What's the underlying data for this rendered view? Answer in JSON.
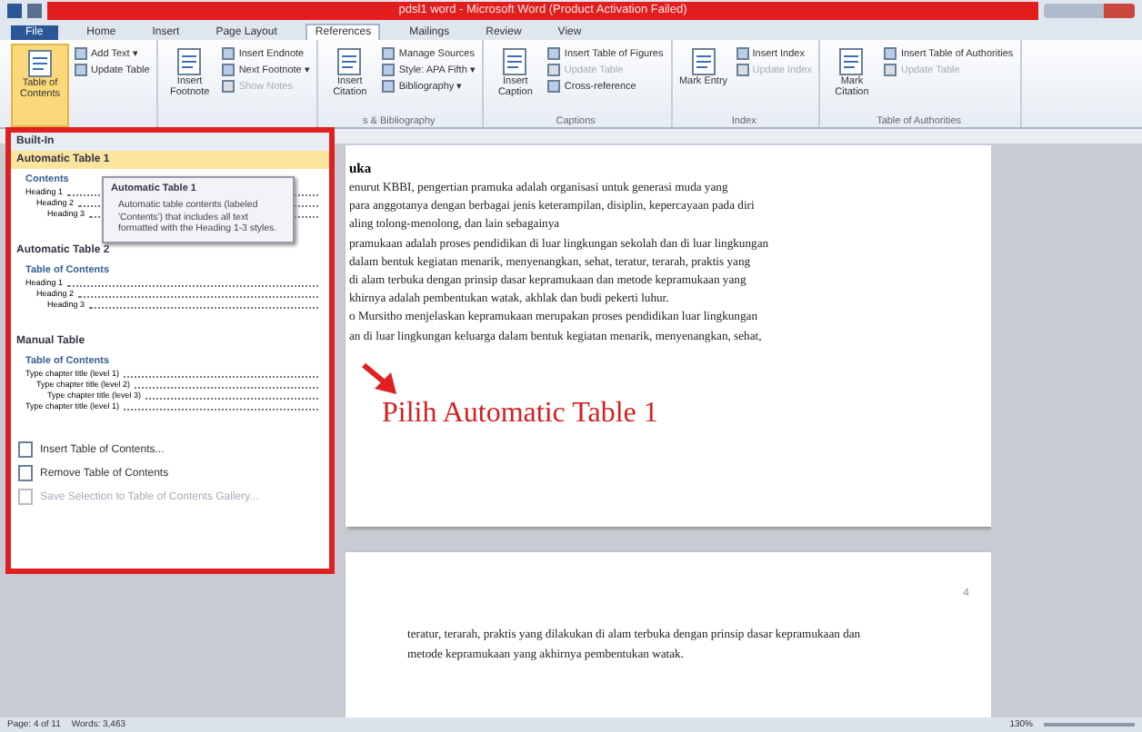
{
  "window": {
    "title": "pdsl1 word - Microsoft Word (Product Activation Failed)"
  },
  "tabs": [
    {
      "label": "File",
      "selected": false,
      "kind": "file"
    },
    {
      "label": "Home",
      "selected": false
    },
    {
      "label": "Insert",
      "selected": false
    },
    {
      "label": "Page Layout",
      "selected": false
    },
    {
      "label": "References",
      "selected": true
    },
    {
      "label": "Mailings",
      "selected": false
    },
    {
      "label": "Review",
      "selected": false
    },
    {
      "label": "View",
      "selected": false
    }
  ],
  "ribbon": [
    {
      "big": {
        "label": "Table of Contents",
        "selected": true
      },
      "small": [
        {
          "label": "Add Text ▾",
          "disabled": false
        },
        {
          "label": "Update Table",
          "disabled": false
        }
      ]
    },
    {
      "big": {
        "label": "Insert Footnote",
        "selected": false
      },
      "small": [
        {
          "label": "Insert Endnote",
          "disabled": false
        },
        {
          "label": "Next Footnote ▾",
          "disabled": false
        },
        {
          "label": "Show Notes",
          "disabled": true
        }
      ]
    },
    {
      "big": {
        "label": "Insert Citation",
        "selected": false
      },
      "small": [
        {
          "label": "Manage Sources",
          "disabled": false
        },
        {
          "label": "Style: APA Fifth ▾",
          "disabled": false
        },
        {
          "label": "Bibliography ▾",
          "disabled": false
        }
      ],
      "label": "s & Bibliography"
    },
    {
      "big": {
        "label": "Insert Caption",
        "selected": false
      },
      "small": [
        {
          "label": "Insert Table of Figures",
          "disabled": false
        },
        {
          "label": "Update Table",
          "disabled": true
        },
        {
          "label": "Cross-reference",
          "disabled": false
        }
      ],
      "label": "Captions"
    },
    {
      "big": {
        "label": "Mark Entry",
        "selected": false
      },
      "small": [
        {
          "label": "Insert Index",
          "disabled": false
        },
        {
          "label": "Update Index",
          "disabled": true
        }
      ],
      "label": "Index"
    },
    {
      "big": {
        "label": "Mark Citation",
        "selected": false
      },
      "small": [
        {
          "label": "Insert Table of Authorities",
          "disabled": false
        },
        {
          "label": "Update Table",
          "disabled": true
        }
      ],
      "label": "Table of Authorities"
    }
  ],
  "menu": {
    "header": "Built-In",
    "items": [
      {
        "title": "Automatic Table 1",
        "selected": true,
        "heading": "Contents",
        "lines": [
          "Heading 1",
          "Heading 2",
          "Heading 3"
        ]
      },
      {
        "title": "Automatic Table 2",
        "selected": false,
        "heading": "Table of Contents",
        "lines": [
          "Heading 1",
          "Heading 2",
          "Heading 3"
        ]
      },
      {
        "title": "Manual Table",
        "selected": false,
        "heading": "Table of Contents",
        "lines": [
          "Type chapter title (level 1)",
          "Type chapter title (level 2)",
          "Type chapter title (level 3)",
          "Type chapter title (level 1)"
        ]
      }
    ],
    "tooltip": {
      "title": "Automatic Table 1",
      "text": "Automatic table contents (labeled 'Contents') that includes all text formatted with the Heading 1-3 styles."
    },
    "commands": [
      {
        "label": "Insert Table of Contents...",
        "disabled": false
      },
      {
        "label": "Remove Table of Contents",
        "disabled": false
      },
      {
        "label": "Save Selection to Table of Contents Gallery...",
        "disabled": true
      }
    ]
  },
  "page1": {
    "heading": "uka",
    "lines": [
      "enurut KBBI, pengertian pramuka adalah organisasi untuk generasi muda yang",
      "para anggotanya dengan berbagai jenis keterampilan, disiplin, kepercayaan pada diri",
      "aling tolong-menolong, dan lain sebagainya",
      "pramukaan adalah proses pendidikan di luar lingkungan sekolah dan di luar lingkungan",
      "dalam bentuk kegiatan menarik, menyenangkan, sehat, teratur, terarah, praktis yang",
      "di alam terbuka dengan prinsip dasar kepramukaan dan metode kepramukaan yang",
      "khirnya adalah pembentukan watak, akhlak dan budi pekerti luhur.",
      "o Mursitho menjelaskan kepramukaan merupakan proses pendidikan luar lingkungan",
      "an di luar lingkungan keluarga dalam bentuk kegiatan menarik, menyenangkan, sehat,"
    ]
  },
  "annotation": "Pilih Automatic Table 1",
  "page2": {
    "page_number": "4",
    "lines": [
      "teratur, terarah, praktis yang dilakukan di alam terbuka dengan prinsip dasar kepramukaan dan",
      "metode kepramukaan yang akhirnya pembentukan watak."
    ]
  },
  "status_bar": {
    "page": "Page: 4 of 11",
    "words": "Words: 3,463",
    "zoom": "130%"
  }
}
